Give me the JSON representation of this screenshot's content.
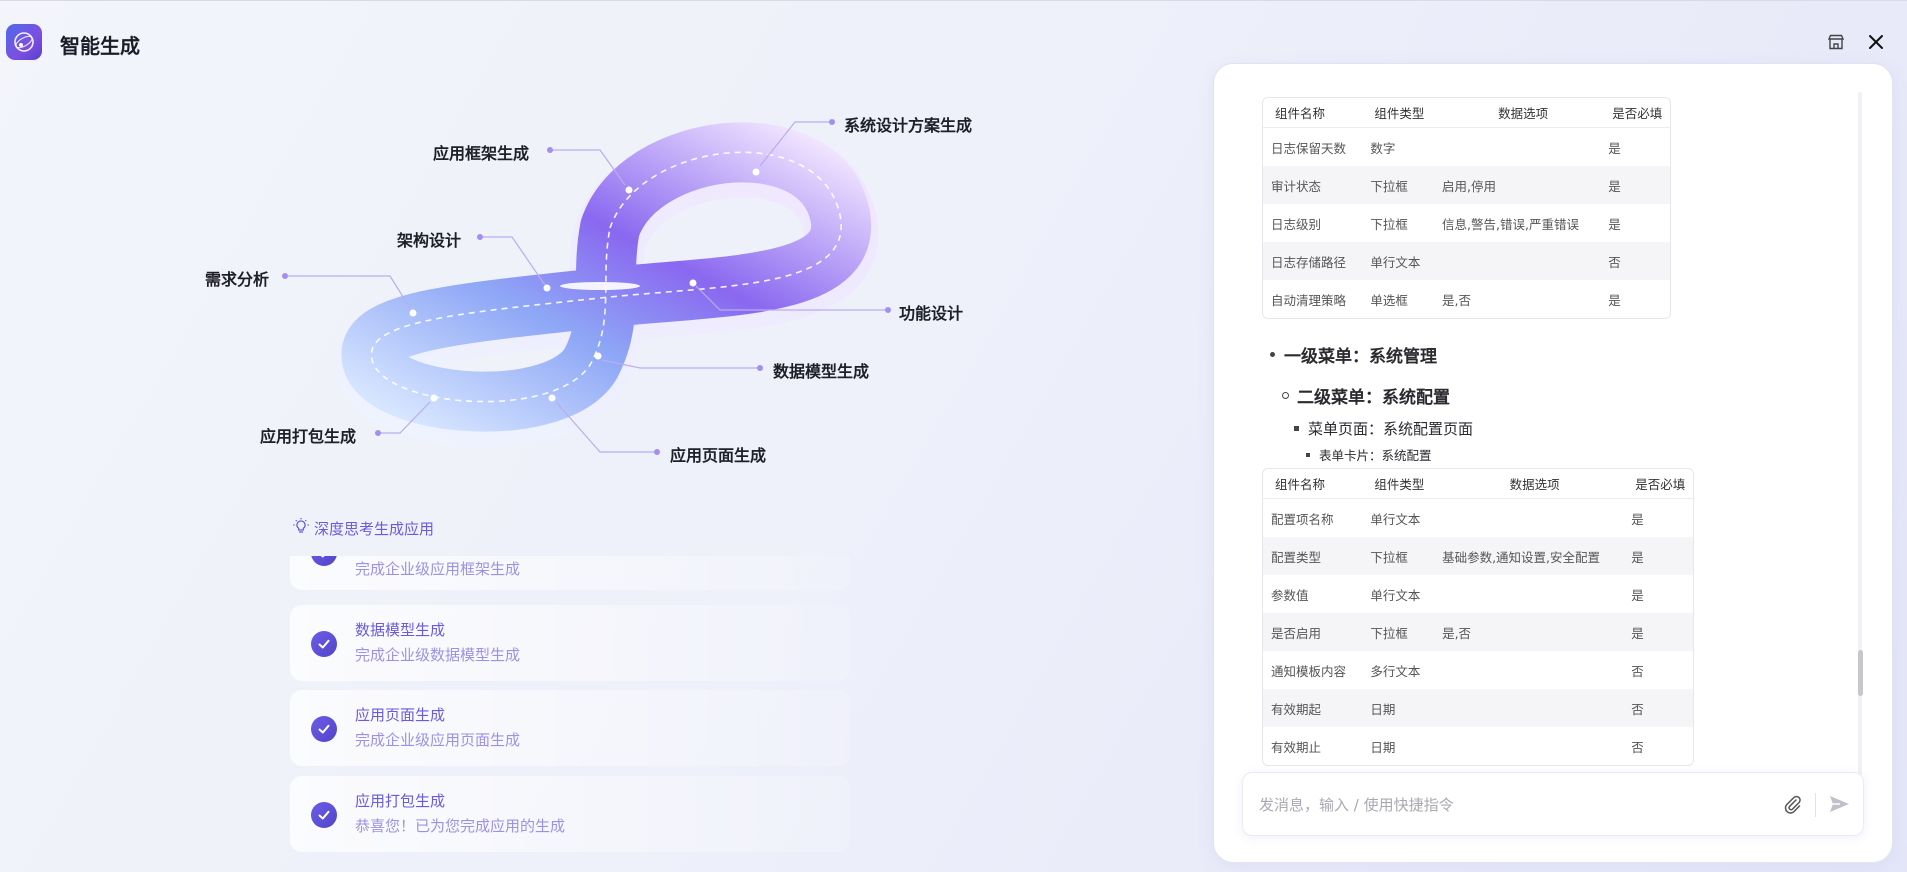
{
  "app": {
    "title": "智能生成"
  },
  "diagram": {
    "nodes": [
      "系统设计方案生成",
      "应用框架生成",
      "架构设计",
      "需求分析",
      "功能设计",
      "数据模型生成",
      "应用打包生成",
      "应用页面生成"
    ]
  },
  "steps": {
    "title": "深度思考生成应用",
    "items": [
      {
        "name": "",
        "desc": "完成企业级应用框架生成"
      },
      {
        "name": "数据模型生成",
        "desc": "完成企业级数据模型生成"
      },
      {
        "name": "应用页面生成",
        "desc": "完成企业级应用页面生成"
      },
      {
        "name": "应用打包生成",
        "desc": "恭喜您！已为您完成应用的生成"
      }
    ]
  },
  "document": {
    "headers": [
      "组件名称",
      "组件类型",
      "数据选项",
      "是否必填"
    ],
    "table1": [
      [
        "日志保留天数",
        "数字",
        "",
        "是"
      ],
      [
        "审计状态",
        "下拉框",
        "启用,停用",
        "是"
      ],
      [
        "日志级别",
        "下拉框",
        "信息,警告,错误,严重错误",
        "是"
      ],
      [
        "日志存储路径",
        "单行文本",
        "",
        "否"
      ],
      [
        "自动清理策略",
        "单选框",
        "是,否",
        "是"
      ]
    ],
    "menu_level1": "一级菜单：系统管理",
    "menu_level2": "二级菜单：系统配置",
    "menu_page": "菜单页面：系统配置页面",
    "form_card": "表单卡片：系统配置",
    "table2": [
      [
        "配置项名称",
        "单行文本",
        "",
        "是"
      ],
      [
        "配置类型",
        "下拉框",
        "基础参数,通知设置,安全配置",
        "是"
      ],
      [
        "参数值",
        "单行文本",
        "",
        "是"
      ],
      [
        "是否启用",
        "下拉框",
        "是,否",
        "是"
      ],
      [
        "通知模板内容",
        "多行文本",
        "",
        "否"
      ],
      [
        "有效期起",
        "日期",
        "",
        "否"
      ],
      [
        "有效期止",
        "日期",
        "",
        "否"
      ]
    ]
  },
  "chat": {
    "placeholder": "发消息，输入 / 使用快捷指令"
  },
  "icons": {
    "logo": "app-logo-icon",
    "store": "store-icon",
    "close": "close-icon",
    "bulb": "lightbulb-icon",
    "check": "check-icon",
    "attach": "paperclip-icon",
    "send": "send-icon"
  },
  "colors": {
    "accent": "#6a5ae0",
    "accent_light": "#9c92e4",
    "check_bg": "#5f52d8"
  }
}
